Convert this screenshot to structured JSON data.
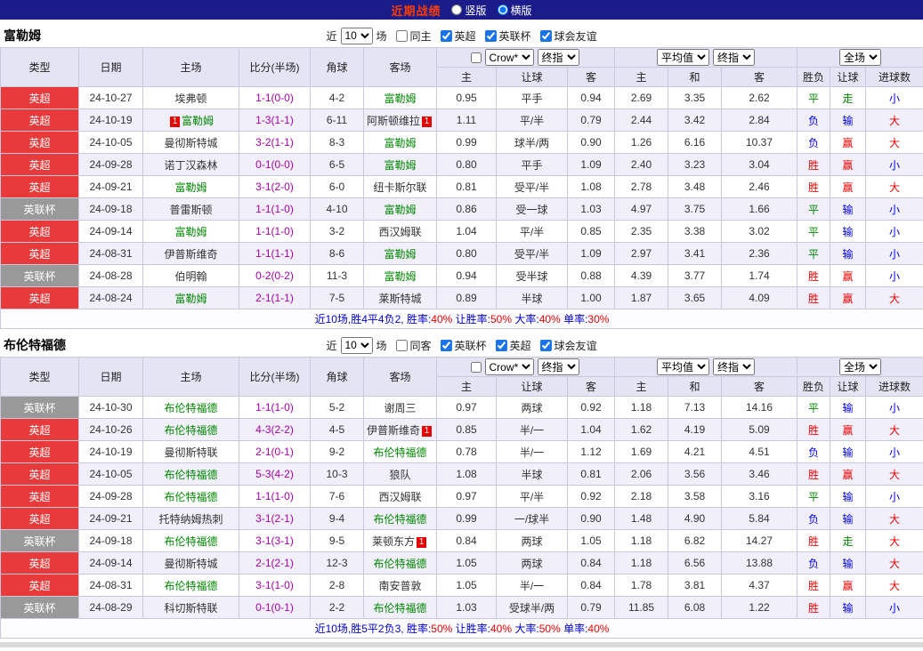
{
  "topbar": {
    "title": "近期战绩",
    "options": [
      {
        "label": "竖版",
        "selected": false
      },
      {
        "label": "横版",
        "selected": true
      }
    ]
  },
  "columns": {
    "main": [
      "类型",
      "日期",
      "主场",
      "比分(半场)",
      "角球",
      "客场"
    ],
    "sub": [
      "主",
      "让球",
      "客",
      "主",
      "和",
      "客",
      "胜负",
      "让球",
      "进球数"
    ]
  },
  "controls": {
    "near_label": "近",
    "count": "10",
    "unit_label": "场",
    "odds_source": "Crow*",
    "odds_stage": "终指",
    "avg_label": "平均值",
    "avg_stage": "终指",
    "scope": "全场"
  },
  "colors": {
    "topbar_bg": "#1b1b8a",
    "title": "#ff3d00",
    "epl_bg": "#e83a3a",
    "cup_bg": "#999999",
    "focal_team": "#008800",
    "score": "#aa00aa",
    "win": "#ee0000",
    "lose": "#0000ee",
    "draw": "#008800",
    "big": "#ee0000",
    "small": "#0000ee",
    "link_blue": "#0000cc"
  },
  "sections": [
    {
      "team": "富勒姆",
      "filter": {
        "same_label": "同主",
        "same_checked": false,
        "leagues": [
          {
            "label": "英超",
            "checked": true
          },
          {
            "label": "英联杯",
            "checked": true
          },
          {
            "label": "球会友谊",
            "checked": true
          }
        ]
      },
      "rows": [
        {
          "type": "英超",
          "date": "24-10-27",
          "home": "埃弗顿",
          "home_focal": false,
          "home_badge": "",
          "score": "1-1(0-0)",
          "corner": "4-2",
          "away": "富勒姆",
          "away_focal": true,
          "away_badge": "",
          "odds": [
            "0.95",
            "平手",
            "0.94"
          ],
          "avg": [
            "2.69",
            "3.35",
            "2.62"
          ],
          "result": "平",
          "let_result": "走",
          "goals": "小"
        },
        {
          "type": "英超",
          "date": "24-10-19",
          "home": "富勒姆",
          "home_focal": true,
          "home_badge": "1",
          "score": "1-3(1-1)",
          "corner": "6-11",
          "away": "阿斯顿维拉",
          "away_focal": false,
          "away_badge": "1",
          "odds": [
            "1.11",
            "平/半",
            "0.79"
          ],
          "avg": [
            "2.44",
            "3.42",
            "2.84"
          ],
          "result": "负",
          "let_result": "输",
          "goals": "大"
        },
        {
          "type": "英超",
          "date": "24-10-05",
          "home": "曼彻斯特城",
          "home_focal": false,
          "home_badge": "",
          "score": "3-2(1-1)",
          "corner": "8-3",
          "away": "富勒姆",
          "away_focal": true,
          "away_badge": "",
          "odds": [
            "0.99",
            "球半/两",
            "0.90"
          ],
          "avg": [
            "1.26",
            "6.16",
            "10.37"
          ],
          "result": "负",
          "let_result": "赢",
          "goals": "大"
        },
        {
          "type": "英超",
          "date": "24-09-28",
          "home": "诺丁汉森林",
          "home_focal": false,
          "home_badge": "",
          "score": "0-1(0-0)",
          "corner": "6-5",
          "away": "富勒姆",
          "away_focal": true,
          "away_badge": "",
          "odds": [
            "0.80",
            "平手",
            "1.09"
          ],
          "avg": [
            "2.40",
            "3.23",
            "3.04"
          ],
          "result": "胜",
          "let_result": "赢",
          "goals": "小"
        },
        {
          "type": "英超",
          "date": "24-09-21",
          "home": "富勒姆",
          "home_focal": true,
          "home_badge": "",
          "score": "3-1(2-0)",
          "corner": "6-0",
          "away": "纽卡斯尔联",
          "away_focal": false,
          "away_badge": "",
          "odds": [
            "0.81",
            "受平/半",
            "1.08"
          ],
          "avg": [
            "2.78",
            "3.48",
            "2.46"
          ],
          "result": "胜",
          "let_result": "赢",
          "goals": "大"
        },
        {
          "type": "英联杯",
          "date": "24-09-18",
          "home": "普雷斯顿",
          "home_focal": false,
          "home_badge": "",
          "score": "1-1(1-0)",
          "corner": "4-10",
          "away": "富勒姆",
          "away_focal": true,
          "away_badge": "",
          "odds": [
            "0.86",
            "受一球",
            "1.03"
          ],
          "avg": [
            "4.97",
            "3.75",
            "1.66"
          ],
          "result": "平",
          "let_result": "输",
          "goals": "小"
        },
        {
          "type": "英超",
          "date": "24-09-14",
          "home": "富勒姆",
          "home_focal": true,
          "home_badge": "",
          "score": "1-1(1-0)",
          "corner": "3-2",
          "away": "西汉姆联",
          "away_focal": false,
          "away_badge": "",
          "odds": [
            "1.04",
            "平/半",
            "0.85"
          ],
          "avg": [
            "2.35",
            "3.38",
            "3.02"
          ],
          "result": "平",
          "let_result": "输",
          "goals": "小"
        },
        {
          "type": "英超",
          "date": "24-08-31",
          "home": "伊普斯维奇",
          "home_focal": false,
          "home_badge": "",
          "score": "1-1(1-1)",
          "corner": "8-6",
          "away": "富勒姆",
          "away_focal": true,
          "away_badge": "",
          "odds": [
            "0.80",
            "受平/半",
            "1.09"
          ],
          "avg": [
            "2.97",
            "3.41",
            "2.36"
          ],
          "result": "平",
          "let_result": "输",
          "goals": "小"
        },
        {
          "type": "英联杯",
          "date": "24-08-28",
          "home": "伯明翰",
          "home_focal": false,
          "home_badge": "",
          "score": "0-2(0-2)",
          "corner": "11-3",
          "away": "富勒姆",
          "away_focal": true,
          "away_badge": "",
          "odds": [
            "0.94",
            "受半球",
            "0.88"
          ],
          "avg": [
            "4.39",
            "3.77",
            "1.74"
          ],
          "result": "胜",
          "let_result": "赢",
          "goals": "小"
        },
        {
          "type": "英超",
          "date": "24-08-24",
          "home": "富勒姆",
          "home_focal": true,
          "home_badge": "",
          "score": "2-1(1-1)",
          "corner": "7-5",
          "away": "莱斯特城",
          "away_focal": false,
          "away_badge": "",
          "odds": [
            "0.89",
            "半球",
            "1.00"
          ],
          "avg": [
            "1.87",
            "3.65",
            "4.09"
          ],
          "result": "胜",
          "let_result": "赢",
          "goals": "大"
        }
      ],
      "summary": [
        {
          "text": "近10场,胜4平4负2, 胜率:",
          "color": "blue"
        },
        {
          "text": "40%",
          "color": "red"
        },
        {
          "text": " 让胜率:",
          "color": "blue"
        },
        {
          "text": "50%",
          "color": "red"
        },
        {
          "text": " 大率:",
          "color": "blue"
        },
        {
          "text": "40%",
          "color": "red"
        },
        {
          "text": " 单率:",
          "color": "blue"
        },
        {
          "text": "30%",
          "color": "red"
        }
      ]
    },
    {
      "team": "布伦特福德",
      "filter": {
        "same_label": "同客",
        "same_checked": false,
        "leagues": [
          {
            "label": "英联杯",
            "checked": true
          },
          {
            "label": "英超",
            "checked": true
          },
          {
            "label": "球会友谊",
            "checked": true
          }
        ]
      },
      "rows": [
        {
          "type": "英联杯",
          "date": "24-10-30",
          "home": "布伦特福德",
          "home_focal": true,
          "home_badge": "",
          "score": "1-1(1-0)",
          "corner": "5-2",
          "away": "谢周三",
          "away_focal": false,
          "away_badge": "",
          "odds": [
            "0.97",
            "两球",
            "0.92"
          ],
          "avg": [
            "1.18",
            "7.13",
            "14.16"
          ],
          "result": "平",
          "let_result": "输",
          "goals": "小"
        },
        {
          "type": "英超",
          "date": "24-10-26",
          "home": "布伦特福德",
          "home_focal": true,
          "home_badge": "",
          "score": "4-3(2-2)",
          "corner": "4-5",
          "away": "伊普斯维奇",
          "away_focal": false,
          "away_badge": "1",
          "odds": [
            "0.85",
            "半/一",
            "1.04"
          ],
          "avg": [
            "1.62",
            "4.19",
            "5.09"
          ],
          "result": "胜",
          "let_result": "赢",
          "goals": "大"
        },
        {
          "type": "英超",
          "date": "24-10-19",
          "home": "曼彻斯特联",
          "home_focal": false,
          "home_badge": "",
          "score": "2-1(0-1)",
          "corner": "9-2",
          "away": "布伦特福德",
          "away_focal": true,
          "away_badge": "",
          "odds": [
            "0.78",
            "半/一",
            "1.12"
          ],
          "avg": [
            "1.69",
            "4.21",
            "4.51"
          ],
          "result": "负",
          "let_result": "输",
          "goals": "小"
        },
        {
          "type": "英超",
          "date": "24-10-05",
          "home": "布伦特福德",
          "home_focal": true,
          "home_badge": "",
          "score": "5-3(4-2)",
          "corner": "10-3",
          "away": "狼队",
          "away_focal": false,
          "away_badge": "",
          "odds": [
            "1.08",
            "半球",
            "0.81"
          ],
          "avg": [
            "2.06",
            "3.56",
            "3.46"
          ],
          "result": "胜",
          "let_result": "赢",
          "goals": "大"
        },
        {
          "type": "英超",
          "date": "24-09-28",
          "home": "布伦特福德",
          "home_focal": true,
          "home_badge": "",
          "score": "1-1(1-0)",
          "corner": "7-6",
          "away": "西汉姆联",
          "away_focal": false,
          "away_badge": "",
          "odds": [
            "0.97",
            "平/半",
            "0.92"
          ],
          "avg": [
            "2.18",
            "3.58",
            "3.16"
          ],
          "result": "平",
          "let_result": "输",
          "goals": "小"
        },
        {
          "type": "英超",
          "date": "24-09-21",
          "home": "托特纳姆热刺",
          "home_focal": false,
          "home_badge": "",
          "score": "3-1(2-1)",
          "corner": "9-4",
          "away": "布伦特福德",
          "away_focal": true,
          "away_badge": "",
          "odds": [
            "0.99",
            "一/球半",
            "0.90"
          ],
          "avg": [
            "1.48",
            "4.90",
            "5.84"
          ],
          "result": "负",
          "let_result": "输",
          "goals": "大"
        },
        {
          "type": "英联杯",
          "date": "24-09-18",
          "home": "布伦特福德",
          "home_focal": true,
          "home_badge": "",
          "score": "3-1(3-1)",
          "corner": "9-5",
          "away": "莱顿东方",
          "away_focal": false,
          "away_badge": "1",
          "odds": [
            "0.84",
            "两球",
            "1.05"
          ],
          "avg": [
            "1.18",
            "6.82",
            "14.27"
          ],
          "result": "胜",
          "let_result": "走",
          "goals": "大"
        },
        {
          "type": "英超",
          "date": "24-09-14",
          "home": "曼彻斯特城",
          "home_focal": false,
          "home_badge": "",
          "score": "2-1(2-1)",
          "corner": "12-3",
          "away": "布伦特福德",
          "away_focal": true,
          "away_badge": "",
          "odds": [
            "1.05",
            "两球",
            "0.84"
          ],
          "avg": [
            "1.18",
            "6.56",
            "13.88"
          ],
          "result": "负",
          "let_result": "输",
          "goals": "大"
        },
        {
          "type": "英超",
          "date": "24-08-31",
          "home": "布伦特福德",
          "home_focal": true,
          "home_badge": "",
          "score": "3-1(1-0)",
          "corner": "2-8",
          "away": "南安普敦",
          "away_focal": false,
          "away_badge": "",
          "odds": [
            "1.05",
            "半/一",
            "0.84"
          ],
          "avg": [
            "1.78",
            "3.81",
            "4.37"
          ],
          "result": "胜",
          "let_result": "赢",
          "goals": "大"
        },
        {
          "type": "英联杯",
          "date": "24-08-29",
          "home": "科切斯特联",
          "home_focal": false,
          "home_badge": "",
          "score": "0-1(0-1)",
          "corner": "2-2",
          "away": "布伦特福德",
          "away_focal": true,
          "away_badge": "",
          "odds": [
            "1.03",
            "受球半/两",
            "0.79"
          ],
          "avg": [
            "11.85",
            "6.08",
            "1.22"
          ],
          "result": "胜",
          "let_result": "输",
          "goals": "小"
        }
      ],
      "summary": [
        {
          "text": "近10场,胜5平2负3, 胜率:",
          "color": "blue"
        },
        {
          "text": "50%",
          "color": "red"
        },
        {
          "text": " 让胜率:",
          "color": "blue"
        },
        {
          "text": "40%",
          "color": "red"
        },
        {
          "text": " 大率:",
          "color": "blue"
        },
        {
          "text": "50%",
          "color": "red"
        },
        {
          "text": " 单率:",
          "color": "blue"
        },
        {
          "text": "40%",
          "color": "red"
        }
      ]
    }
  ]
}
